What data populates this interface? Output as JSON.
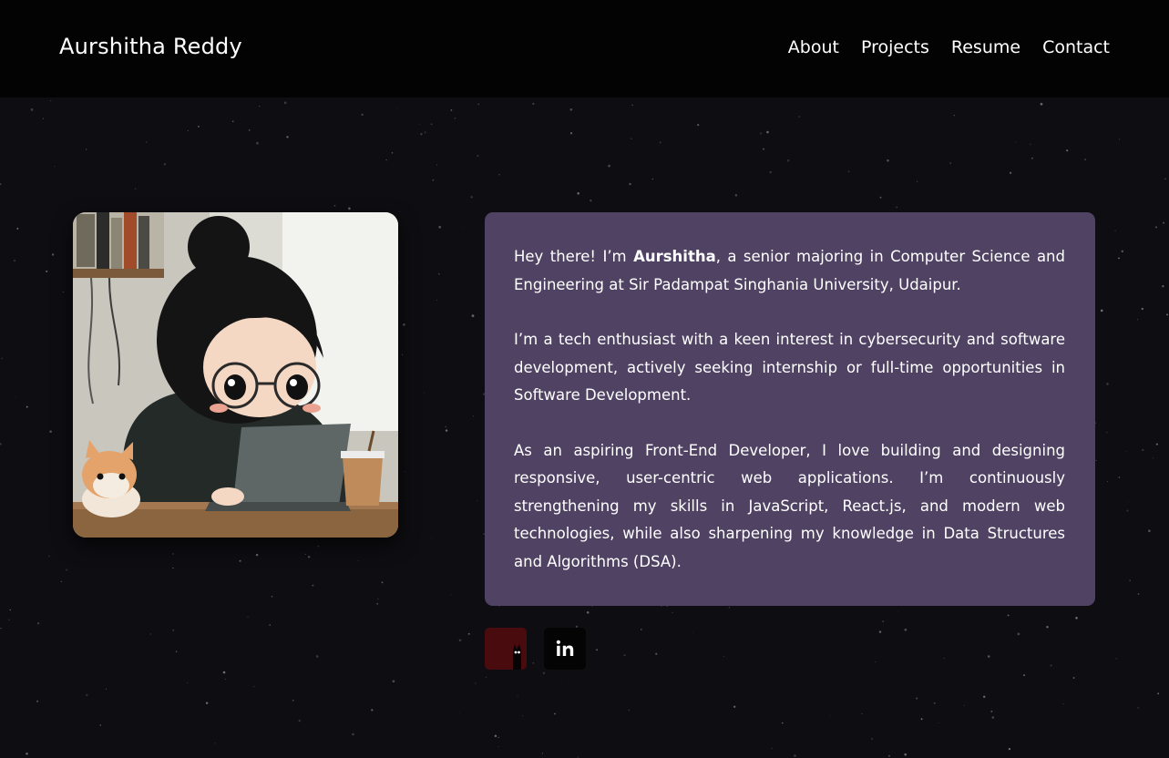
{
  "header": {
    "brand": "Aurshitha Reddy",
    "nav": [
      "About",
      "Projects",
      "Resume",
      "Contact"
    ]
  },
  "about": {
    "p1_before": "Hey there! I’m ",
    "p1_name": "Aurshitha",
    "p1_after": ", a senior majoring in Computer Science and Engineering at Sir Padampat Singhania University, Udaipur.",
    "p2": "I’m a tech enthusiast with a keen interest in cybersecurity and software development, actively seeking internship or full-time opportunities in Software Development.",
    "p3": "As an aspiring Front-End Developer, I love building and designing responsive, user-centric web applications. I’m continuously strengthening my skills in JavaScript, React.js, and modern web technologies, while also sharpening my knowledge in Data Structures and Algorithms (DSA)."
  },
  "social": {
    "linkedin_label": "in"
  },
  "colors": {
    "page_bg": "#0e0e12",
    "navbar_bg": "#030303",
    "card_bg": "#4f4263",
    "social_first_bg": "#4a0b0e",
    "social_second_bg": "#040404"
  },
  "icons": [
    "github-cat-icon",
    "linkedin-icon"
  ]
}
